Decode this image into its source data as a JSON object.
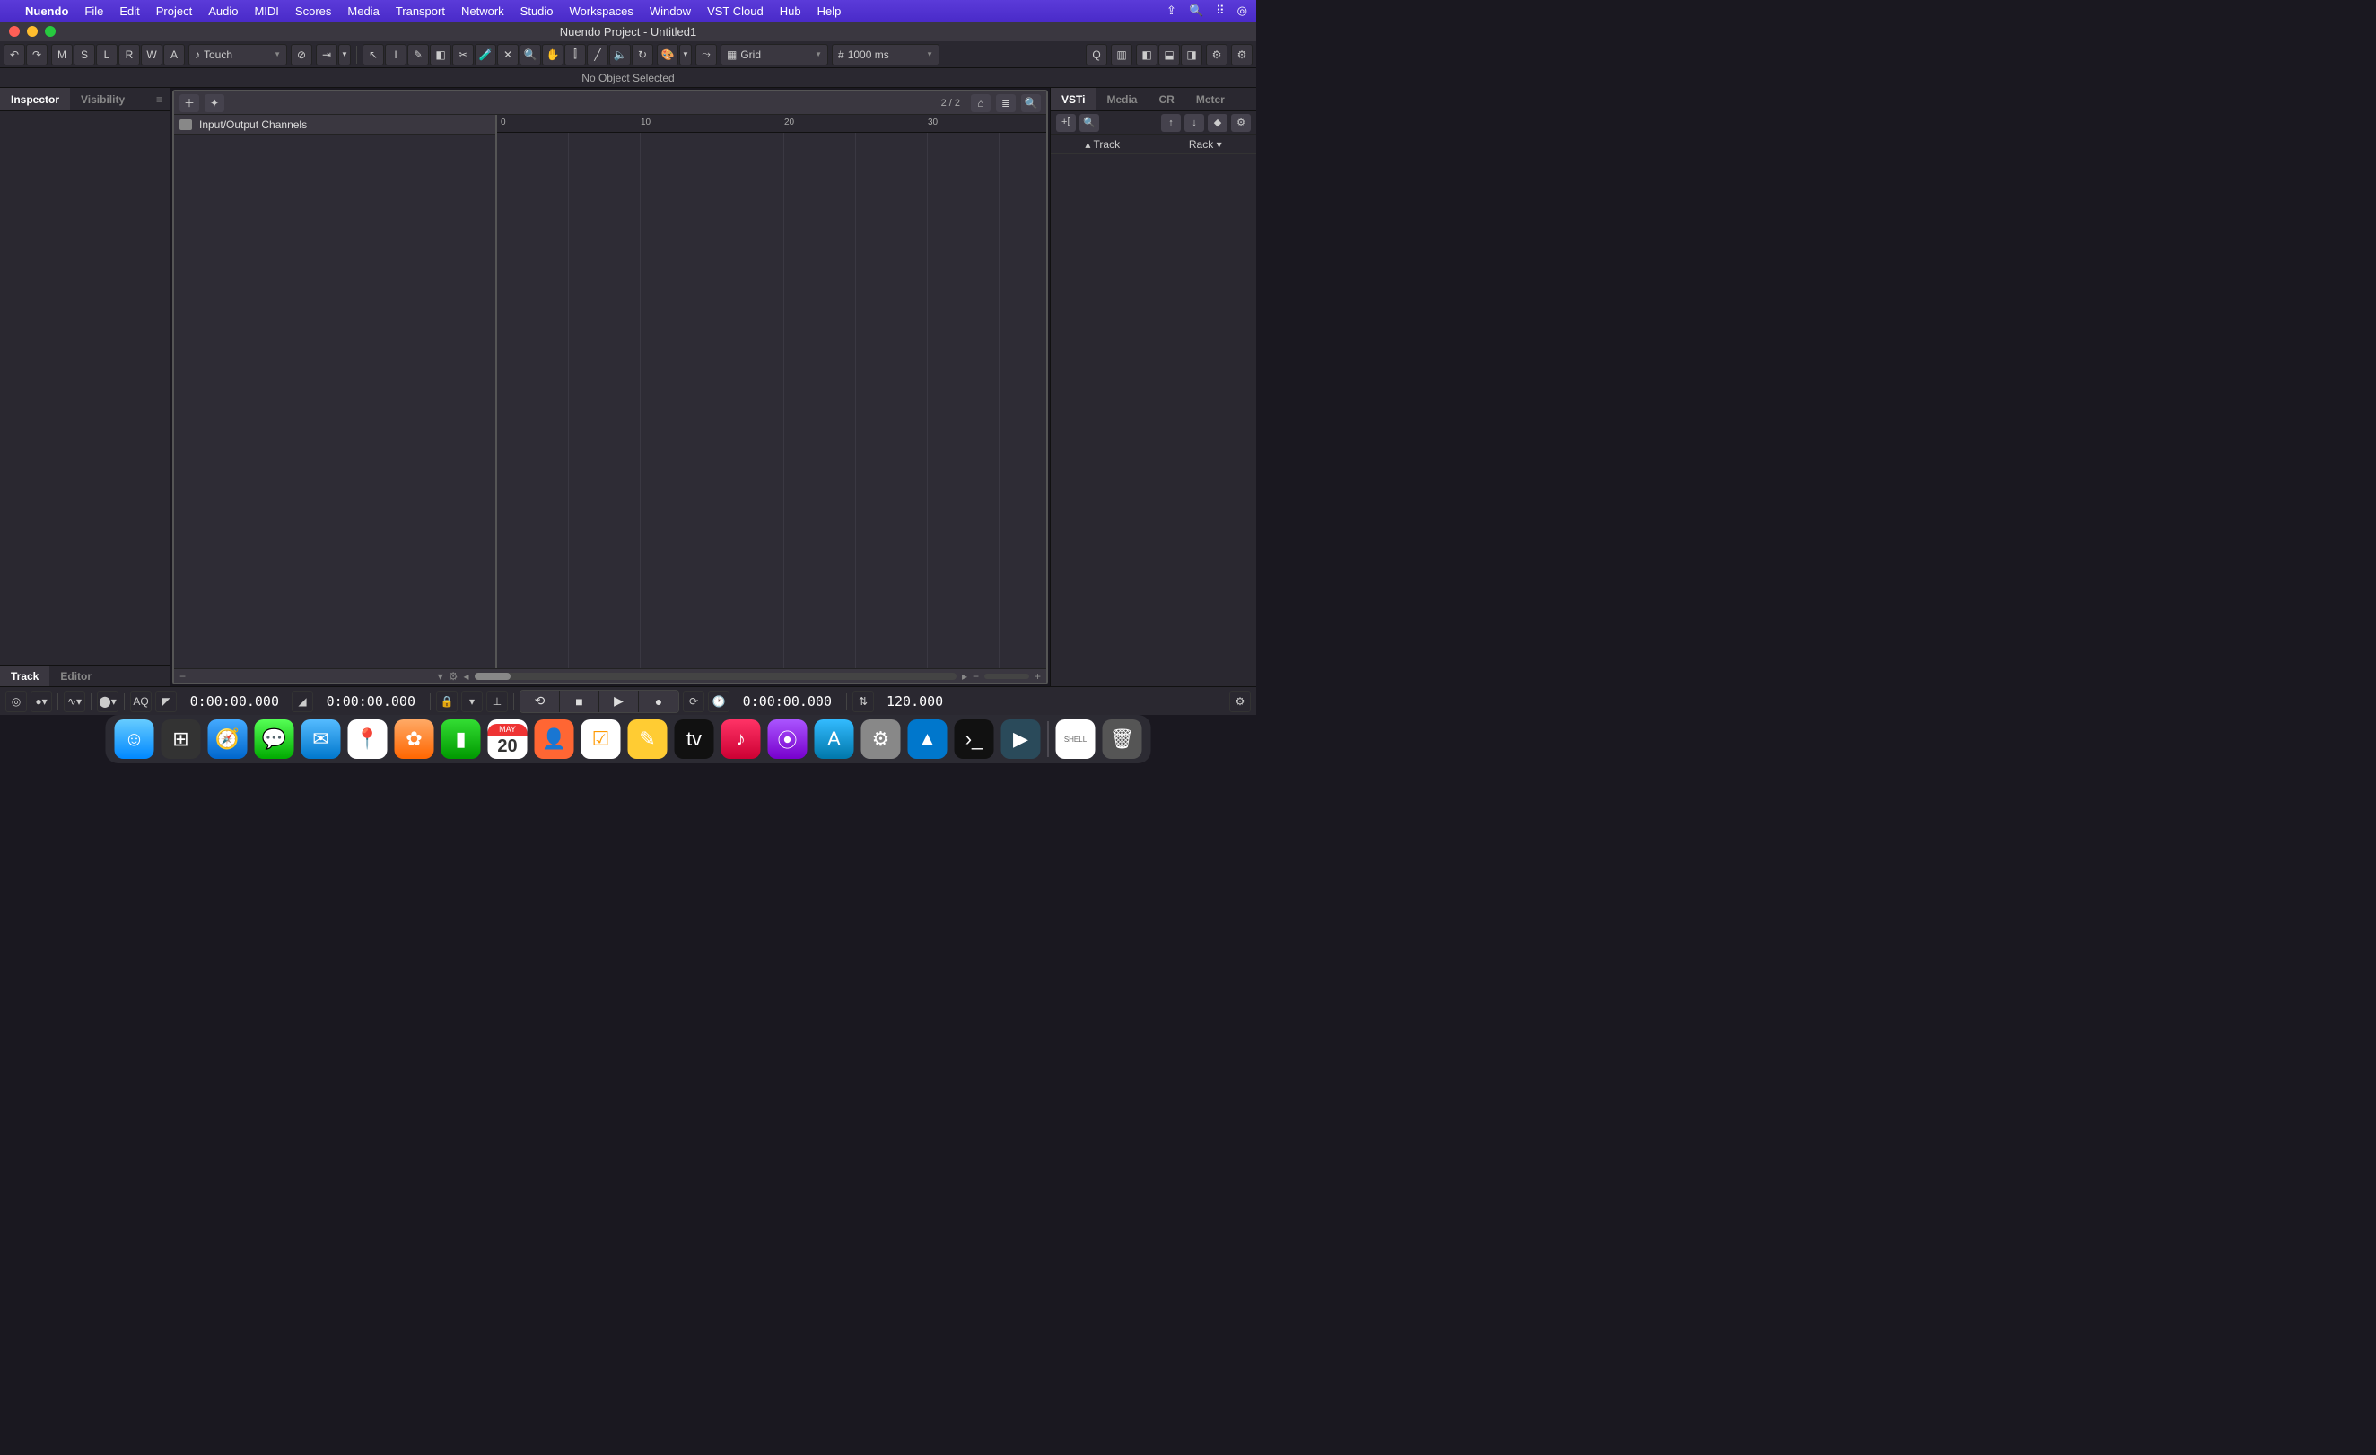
{
  "menubar": {
    "app": "Nuendo",
    "items": [
      "File",
      "Edit",
      "Project",
      "Audio",
      "MIDI",
      "Scores",
      "Media",
      "Transport",
      "Network",
      "Studio",
      "Workspaces",
      "Window",
      "VST Cloud",
      "Hub",
      "Help"
    ]
  },
  "window": {
    "title": "Nuendo Project - Untitled1"
  },
  "toolbar": {
    "state_buttons": [
      "M",
      "S",
      "L",
      "R",
      "W",
      "A"
    ],
    "automation_mode": "Touch",
    "snap_type": "Grid",
    "grid_value": "1000 ms"
  },
  "infoline": {
    "msg": "No Object Selected"
  },
  "left": {
    "tabs": [
      "Inspector",
      "Visibility"
    ],
    "active": 0,
    "bottom_tabs": [
      "Track",
      "Editor"
    ]
  },
  "tracklist": {
    "visibility_count": "2 / 2",
    "tracks": [
      "Input/Output Channels"
    ]
  },
  "ruler": {
    "marks": [
      0,
      10,
      20,
      30
    ]
  },
  "right": {
    "tabs": [
      "VSTi",
      "Media",
      "CR",
      "Meter"
    ],
    "active": 0,
    "rack_left": "Track",
    "rack_right": "Rack"
  },
  "transport": {
    "left_time": "0:00:00.000",
    "right_time": "0:00:00.000",
    "main_time": "0:00:00.000",
    "tempo": "120.000"
  },
  "dock": {
    "calendar_month": "MAY",
    "calendar_day": "20",
    "tv_label": "tv"
  }
}
